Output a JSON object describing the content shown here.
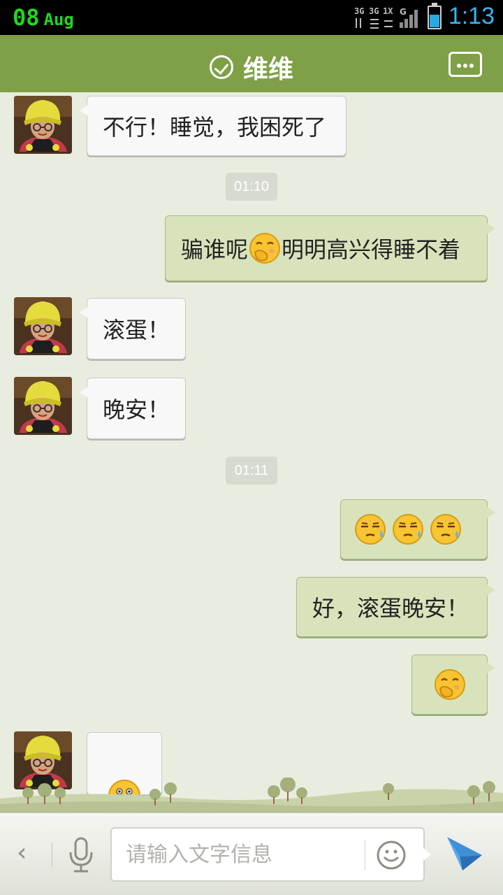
{
  "status_bar": {
    "date_day": "08",
    "date_month": "Aug",
    "network_icon": "3g-data-icon",
    "signal_icon": "signal-bars-icon",
    "battery_icon": "battery-icon",
    "time": "1:13",
    "colors": {
      "date": "#1fd81f",
      "time": "#38b4ea"
    }
  },
  "header": {
    "title": "维维",
    "verified_icon": "check-circle-icon",
    "more_icon": "chat-more-icon",
    "bg_color": "#7fa046"
  },
  "messages": [
    {
      "side": "left",
      "text": "不行！睡觉，我困死了"
    },
    {
      "type": "time",
      "text": "01:10"
    },
    {
      "side": "right",
      "text_before": "骗谁呢",
      "emoji": "giggle-emoji",
      "text_after": "明明高兴得睡不着"
    },
    {
      "side": "left",
      "text": "滚蛋！"
    },
    {
      "side": "left",
      "text": "晚安！"
    },
    {
      "type": "time",
      "text": "01:11"
    },
    {
      "side": "right",
      "emojis": [
        "sweat-emoji",
        "sweat-emoji",
        "sweat-emoji"
      ]
    },
    {
      "side": "right",
      "text": "好，滚蛋晚安！"
    },
    {
      "side": "right",
      "emoji": "giggle-emoji"
    },
    {
      "side": "left",
      "emoji": "peek-emoji"
    }
  ],
  "input_bar": {
    "back_icon": "chevron-left-icon",
    "voice_icon": "microphone-icon",
    "placeholder": "请输入文字信息",
    "emoji_icon": "smiley-icon",
    "send_icon": "send-arrow-icon"
  }
}
